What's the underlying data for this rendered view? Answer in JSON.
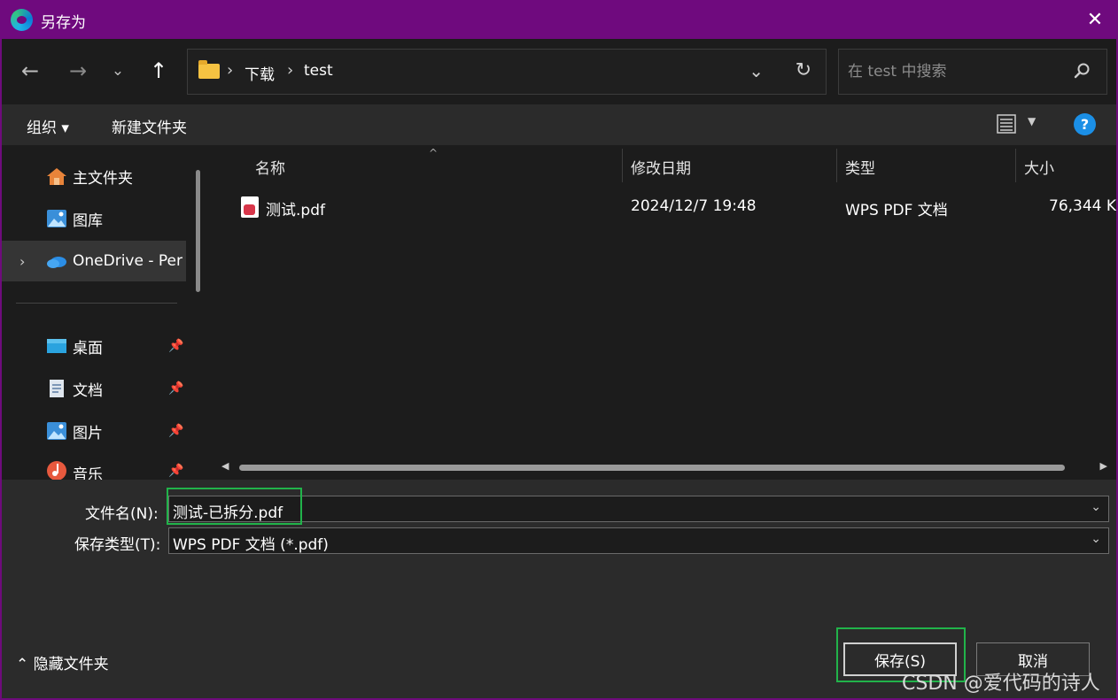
{
  "window": {
    "title": "另存为",
    "close_label": "✕"
  },
  "nav": {
    "back_icon": "←",
    "forward_icon": "→",
    "recent_icon": "⌄",
    "up_icon": "↑"
  },
  "address": {
    "crumbs": [
      "下载",
      "test"
    ],
    "separator": "›",
    "dropdown_icon": "⌄",
    "refresh_icon": "↻"
  },
  "search": {
    "placeholder": "在 test 中搜索"
  },
  "toolbar": {
    "organize_label": "组织 ▾",
    "new_folder_label": "新建文件夹",
    "view_caret": "▼",
    "help_label": "?"
  },
  "sidebar": {
    "items": [
      {
        "label": "主文件夹",
        "icon": "home-icon"
      },
      {
        "label": "图库",
        "icon": "gallery-icon"
      },
      {
        "label": "OneDrive - Per",
        "icon": "onedrive-icon",
        "expand": "›"
      },
      {
        "label": "桌面",
        "icon": "desktop-icon",
        "pin": "📌"
      },
      {
        "label": "文档",
        "icon": "documents-icon",
        "pin": "📌"
      },
      {
        "label": "图片",
        "icon": "pictures-icon",
        "pin": "📌"
      },
      {
        "label": "音乐",
        "icon": "music-icon",
        "pin": "📌"
      }
    ]
  },
  "columns": {
    "name": "名称",
    "modified": "修改日期",
    "type": "类型",
    "size": "大小",
    "sort_caret": "^"
  },
  "files": [
    {
      "name": "测试.pdf",
      "modified": "2024/12/7 19:48",
      "type": "WPS PDF 文档",
      "size": "76,344 K"
    }
  ],
  "scroll": {
    "left_arrow": "◀",
    "right_arrow": "▶"
  },
  "form": {
    "filename_label": "文件名(N):",
    "filename_value": "测试-已拆分.pdf",
    "filetype_label": "保存类型(T):",
    "filetype_value": "WPS PDF 文档 (*.pdf)",
    "dropdown_icon": "⌄",
    "hide_folders_label": "⌃ 隐藏文件夹",
    "save_label": "保存(S)",
    "cancel_label": "取消"
  },
  "watermark": "CSDN @爱代码的诗人",
  "colors": {
    "titlebar": "#6f0a7e",
    "highlight": "#21b34a",
    "help": "#1b8fe6"
  }
}
